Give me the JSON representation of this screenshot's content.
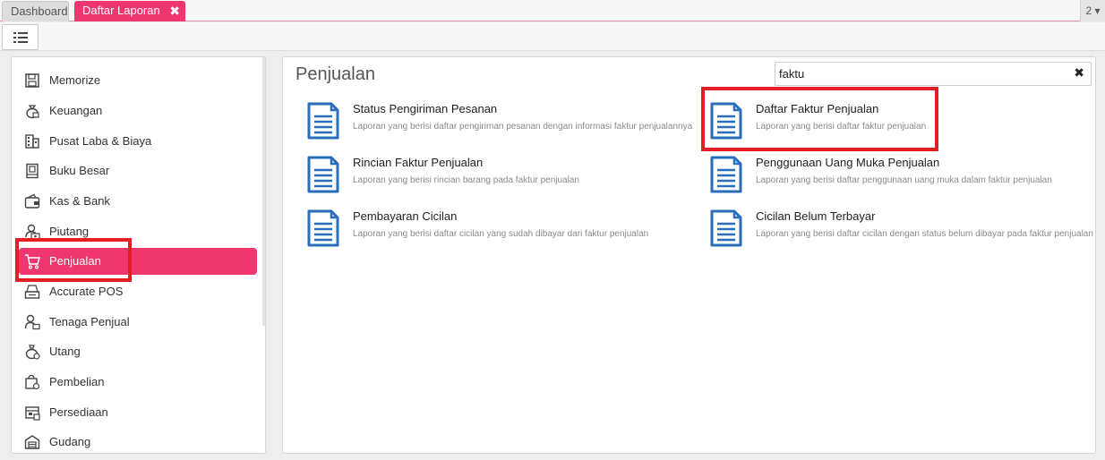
{
  "tabs": {
    "dashboard_label": "Dashboard",
    "active_label": "Daftar Laporan",
    "close_glyph": "✖",
    "counter_label": "2 ▾"
  },
  "toolbar": {
    "list_icon": "list-icon"
  },
  "sidebar": {
    "items": [
      {
        "label": "Memorize",
        "icon": "floppy-disk-icon"
      },
      {
        "label": "Keuangan",
        "icon": "money-bag-icon"
      },
      {
        "label": "Pusat Laba & Biaya",
        "icon": "building-icon"
      },
      {
        "label": "Buku Besar",
        "icon": "ledger-book-icon"
      },
      {
        "label": "Kas & Bank",
        "icon": "wallet-icon"
      },
      {
        "label": "Piutang",
        "icon": "receivable-icon"
      },
      {
        "label": "Penjualan",
        "icon": "cart-icon",
        "active": true
      },
      {
        "label": "Accurate POS",
        "icon": "pos-icon"
      },
      {
        "label": "Tenaga Penjual",
        "icon": "salesperson-icon"
      },
      {
        "label": "Utang",
        "icon": "payable-icon"
      },
      {
        "label": "Pembelian",
        "icon": "purchase-bag-icon"
      },
      {
        "label": "Persediaan",
        "icon": "inventory-box-icon"
      },
      {
        "label": "Gudang",
        "icon": "warehouse-icon"
      }
    ]
  },
  "main": {
    "title": "Penjualan",
    "search": {
      "value": "faktu",
      "clear_glyph": "✖"
    },
    "reports": [
      {
        "title": "Status Pengiriman Pesanan",
        "desc": "Laporan yang berisi daftar pengiriman pesanan dengan informasi faktur penjualannya"
      },
      {
        "title": "Daftar Faktur Penjualan",
        "desc": "Laporan yang berisi daftar faktur penjualan"
      },
      {
        "title": "Rincian Faktur Penjualan",
        "desc": "Laporan yang berisi rincian barang pada faktur penjualan"
      },
      {
        "title": "Penggunaan Uang Muka Penjualan",
        "desc": "Laporan yang berisi daftar penggunaan uang muka dalam faktur penjualan"
      },
      {
        "title": "Pembayaran Cicilan",
        "desc": "Laporan yang berisi daftar cicilan yang sudah dibayar dari faktur penjualan"
      },
      {
        "title": "Cicilan Belum Terbayar",
        "desc": "Laporan yang berisi daftar cicilan dengan status belum dibayar pada faktur penjualan"
      }
    ]
  },
  "colors": {
    "accent": "#f0366e",
    "highlight": "#e31e24",
    "doc_icon": "#2a6ebb"
  }
}
